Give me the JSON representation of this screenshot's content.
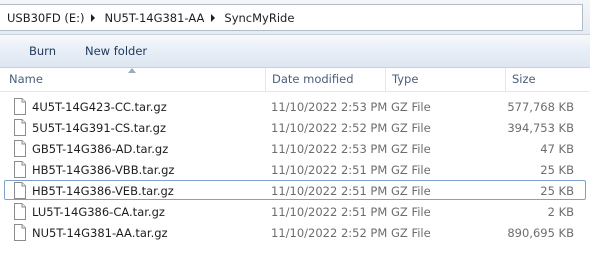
{
  "address_bar": {
    "crumbs": [
      "USB30FD (E:)",
      "NU5T-14G381-AA",
      "SyncMyRide"
    ]
  },
  "toolbar": {
    "burn_label": "Burn",
    "new_folder_label": "New folder"
  },
  "columns": {
    "name": "Name",
    "date_modified": "Date modified",
    "type": "Type",
    "size": "Size"
  },
  "files": [
    {
      "name": "4U5T-14G423-CC.tar.gz",
      "date": "11/10/2022 2:53 PM",
      "type": "GZ File",
      "size": "577,768 KB"
    },
    {
      "name": "5U5T-14G391-CS.tar.gz",
      "date": "11/10/2022 2:52 PM",
      "type": "GZ File",
      "size": "394,753 KB"
    },
    {
      "name": "GB5T-14G386-AD.tar.gz",
      "date": "11/10/2022 2:53 PM",
      "type": "GZ File",
      "size": "47 KB"
    },
    {
      "name": "HB5T-14G386-VBB.tar.gz",
      "date": "11/10/2022 2:51 PM",
      "type": "GZ File",
      "size": "25 KB"
    },
    {
      "name": "HB5T-14G386-VEB.tar.gz",
      "date": "11/10/2022 2:51 PM",
      "type": "GZ File",
      "size": "25 KB"
    },
    {
      "name": "LU5T-14G386-CA.tar.gz",
      "date": "11/10/2022 2:51 PM",
      "type": "GZ File",
      "size": "2 KB"
    },
    {
      "name": "NU5T-14G381-AA.tar.gz",
      "date": "11/10/2022 2:52 PM",
      "type": "GZ File",
      "size": "890,695 KB"
    }
  ],
  "focused_index": 4,
  "sort": {
    "column": "name",
    "direction": "ascending"
  },
  "icons": {
    "breadcrumb_separator": "chevron-right-icon",
    "file": "file-icon",
    "sort": "sort-ascending-icon"
  },
  "colors": {
    "toolbar_text": "#1e395b",
    "header_text": "#4c607a",
    "secondary_text": "#6d6d6d",
    "focus_border": "#7da2ce"
  }
}
